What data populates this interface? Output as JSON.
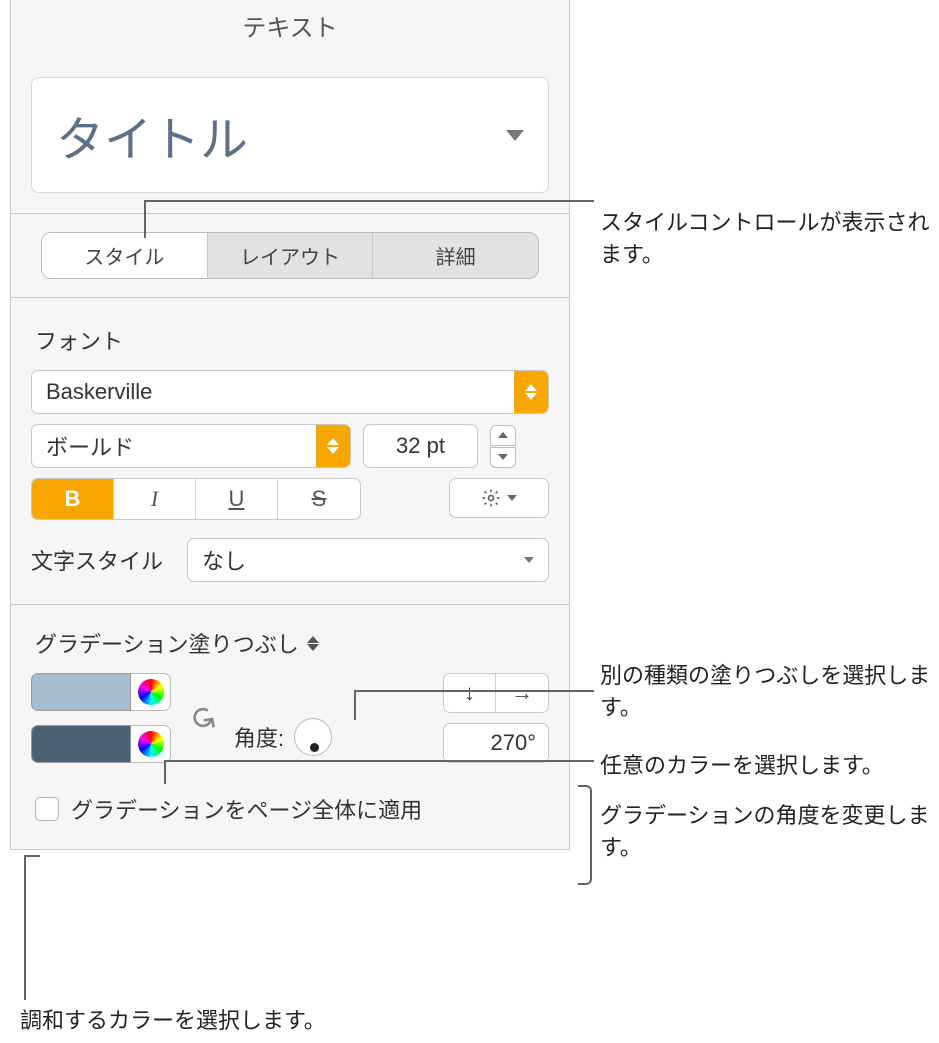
{
  "panel_title": "テキスト",
  "style_name": "タイトル",
  "tabs": {
    "style": "スタイル",
    "layout": "レイアウト",
    "detail": "詳細"
  },
  "font": {
    "section": "フォント",
    "family": "Baskerville",
    "weight": "ボールド",
    "size": "32 pt"
  },
  "bius": {
    "b": "B",
    "i": "I",
    "u": "U",
    "s": "S"
  },
  "char_style": {
    "label": "文字スタイル",
    "value": "なし"
  },
  "fill": {
    "header": "グラデーション塗りつぶし",
    "angle_label": "角度:",
    "angle_value": "270°",
    "apply_page": "グラデーションをページ全体に適用"
  },
  "arrows": {
    "down": "↓",
    "right": "→"
  },
  "callouts": {
    "style_controls": "スタイルコントロールが表示されます。",
    "fill_type": "別の種類の塗りつぶしを選択します。",
    "any_color": "任意のカラーを選択します。",
    "angle": "グラデーションの角度を変更します。",
    "matching_color": "調和するカラーを選択します。"
  }
}
